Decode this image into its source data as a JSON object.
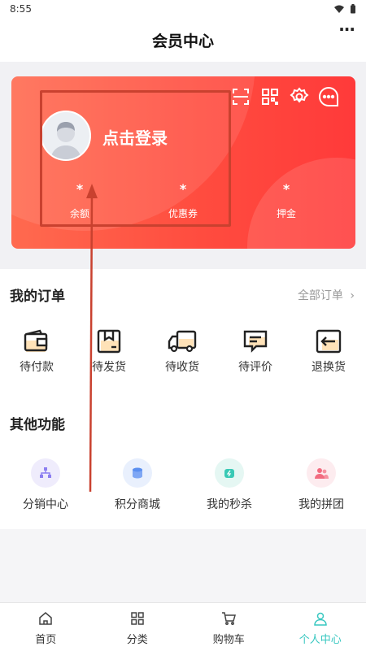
{
  "status": {
    "time": "8:55"
  },
  "header": {
    "title": "会员中心",
    "more": "···"
  },
  "card": {
    "login_text": "点击登录",
    "stats": [
      {
        "value": "*",
        "label": "余额"
      },
      {
        "value": "*",
        "label": "优惠券"
      },
      {
        "value": "*",
        "label": "押金"
      }
    ]
  },
  "orders": {
    "title": "我的订单",
    "view_all": "全部订单",
    "items": [
      {
        "label": "待付款",
        "icon": "wallet-icon"
      },
      {
        "label": "待发货",
        "icon": "package-icon"
      },
      {
        "label": "待收货",
        "icon": "truck-icon"
      },
      {
        "label": "待评价",
        "icon": "comment-icon"
      },
      {
        "label": "退换货",
        "icon": "return-icon"
      }
    ]
  },
  "others": {
    "title": "其他功能",
    "items": [
      {
        "label": "分销中心",
        "icon": "distribution-icon",
        "color": "#8c7ef0"
      },
      {
        "label": "积分商城",
        "icon": "coins-icon",
        "color": "#5b8ff0"
      },
      {
        "label": "我的秒杀",
        "icon": "flash-sale-icon",
        "color": "#39c9b5"
      },
      {
        "label": "我的拼团",
        "icon": "group-buy-icon",
        "color": "#f26b7f"
      }
    ]
  },
  "tabbar": {
    "items": [
      {
        "label": "首页"
      },
      {
        "label": "分类"
      },
      {
        "label": "购物车"
      },
      {
        "label": "个人中心"
      }
    ],
    "active_color": "#37c7c0"
  },
  "colors": {
    "card_red": "#ff4c3f",
    "annotation": "#c9412f"
  }
}
